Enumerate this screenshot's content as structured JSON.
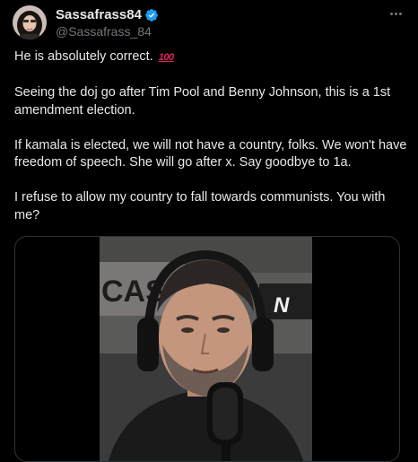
{
  "author": {
    "display_name": "Sassafrass84",
    "handle": "@Sassafrass_84",
    "verified": true,
    "verified_color": "#1d9bf0"
  },
  "tweet": {
    "paragraphs": [
      "He is absolutely correct.",
      "Seeing the doj go after Tim Pool and Benny Johnson, this is a 1st amendment election.",
      "If kamala is elected, we will not have a country, folks. We won't have freedom of speech. She will go after x. Say goodbye to 1a.",
      "I refuse to allow my country to fall towards communists. You with me?"
    ],
    "emoji": "100",
    "emoji_name": "hundred-points-emoji"
  },
  "media": {
    "type": "video",
    "background_sign_text": "CAS",
    "logo_text": "N"
  },
  "colors": {
    "background": "#000000",
    "text": "#e7e9ea",
    "muted": "#71767b",
    "border": "#2f3336",
    "accent": "#1d9bf0"
  }
}
